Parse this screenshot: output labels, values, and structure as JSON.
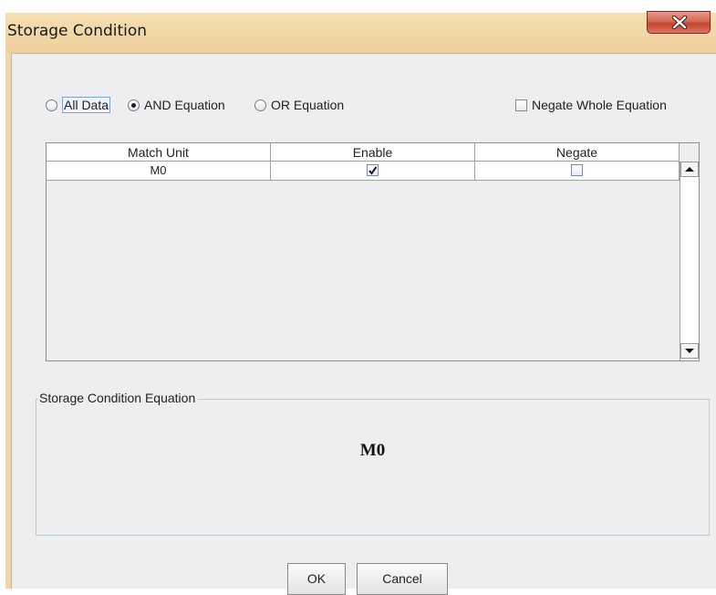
{
  "window": {
    "title": "Storage Condition"
  },
  "mode": {
    "options": [
      {
        "label": "All Data",
        "checked": false
      },
      {
        "label": "AND Equation",
        "checked": true
      },
      {
        "label": "OR Equation",
        "checked": false
      }
    ],
    "negate_whole": {
      "label": "Negate Whole Equation",
      "checked": false
    }
  },
  "table": {
    "columns": [
      "Match Unit",
      "Enable",
      "Negate"
    ],
    "rows": [
      {
        "match_unit": "M0",
        "enable": true,
        "negate": false
      }
    ]
  },
  "equation": {
    "legend": "Storage Condition Equation",
    "value": "M0"
  },
  "buttons": {
    "ok": "OK",
    "cancel": "Cancel"
  },
  "colors": {
    "titlebar": "#f0d6a8",
    "close": "#c5452e",
    "client": "#eeeeee"
  }
}
